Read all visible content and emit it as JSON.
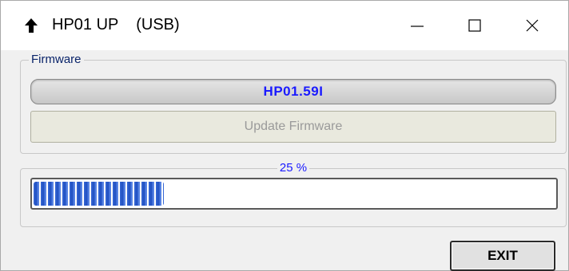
{
  "window": {
    "title": "HP01 UP    (USB)",
    "app_icon": "up-arrow-icon",
    "controls": {
      "minimize": "minimize-icon",
      "maximize": "maximize-icon",
      "close": "close-icon"
    }
  },
  "firmware": {
    "group_label": "Firmware",
    "version": "HP01.59I",
    "update_button_label": "Update Firmware",
    "update_button_enabled": false
  },
  "progress": {
    "label": "25 %",
    "percent": 25
  },
  "footer": {
    "exit_label": "EXIT"
  },
  "colors": {
    "accent_text": "#1a1aff",
    "progress_fill": "#3c6cd8",
    "disabled_text": "#9a9a9a"
  }
}
